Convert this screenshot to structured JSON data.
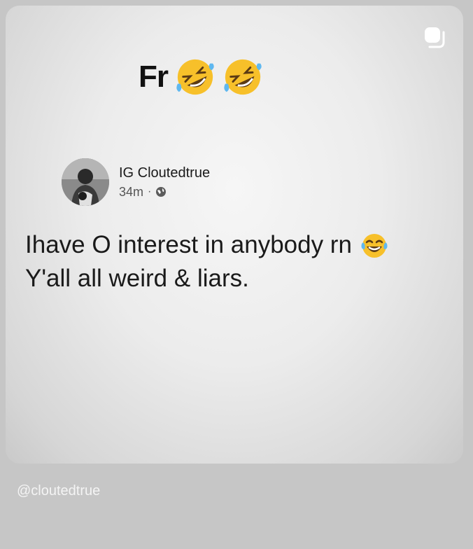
{
  "story": {
    "caption_text": "Fr",
    "caption_emojis": [
      "rolling-on-floor-laughing-emoji",
      "rolling-on-floor-laughing-emoji"
    ],
    "repost_icon": "repost-icon",
    "handle": "@cloutedtrue"
  },
  "post": {
    "author": "IG Cloutedtrue",
    "time": "34m",
    "separator": "·",
    "visibility_icon": "globe-icon",
    "line1": "Ihave O interest in anybody rn",
    "line1_emoji": "tears-of-joy-emoji",
    "line2": "Y'all all weird & liars."
  },
  "colors": {
    "background": "#c6c6c6",
    "emoji_yellow": "#f7c02a",
    "text": "#1a1a1a"
  }
}
